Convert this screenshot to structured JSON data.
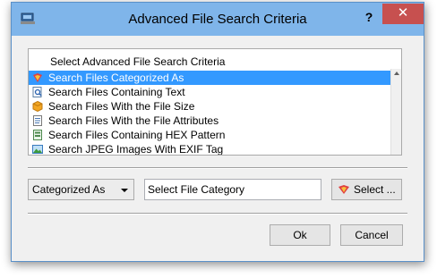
{
  "window": {
    "title": "Advanced File Search Criteria",
    "help_label": "?",
    "close_label": "✕"
  },
  "list": {
    "header": "Select Advanced File Search Criteria",
    "items": [
      {
        "label": "Search Files Categorized As",
        "icon": "category-tag-icon",
        "selected": true
      },
      {
        "label": "Search Files Containing Text",
        "icon": "text-search-icon",
        "selected": false
      },
      {
        "label": "Search Files With the File Size",
        "icon": "file-size-icon",
        "selected": false
      },
      {
        "label": "Search Files With the File Attributes",
        "icon": "file-attributes-icon",
        "selected": false
      },
      {
        "label": "Search Files Containing HEX Pattern",
        "icon": "hex-pattern-icon",
        "selected": false
      },
      {
        "label": "Search JPEG Images With EXIF Tag",
        "icon": "jpeg-exif-icon",
        "selected": false
      }
    ]
  },
  "criteria": {
    "combo_value": "Categorized As",
    "category_value": "Select File Category",
    "select_button": "Select ..."
  },
  "footer": {
    "ok_label": "Ok",
    "cancel_label": "Cancel"
  },
  "colors": {
    "titlebar": "#7fb5ea",
    "selection": "#3399ff",
    "close": "#c7504f"
  }
}
